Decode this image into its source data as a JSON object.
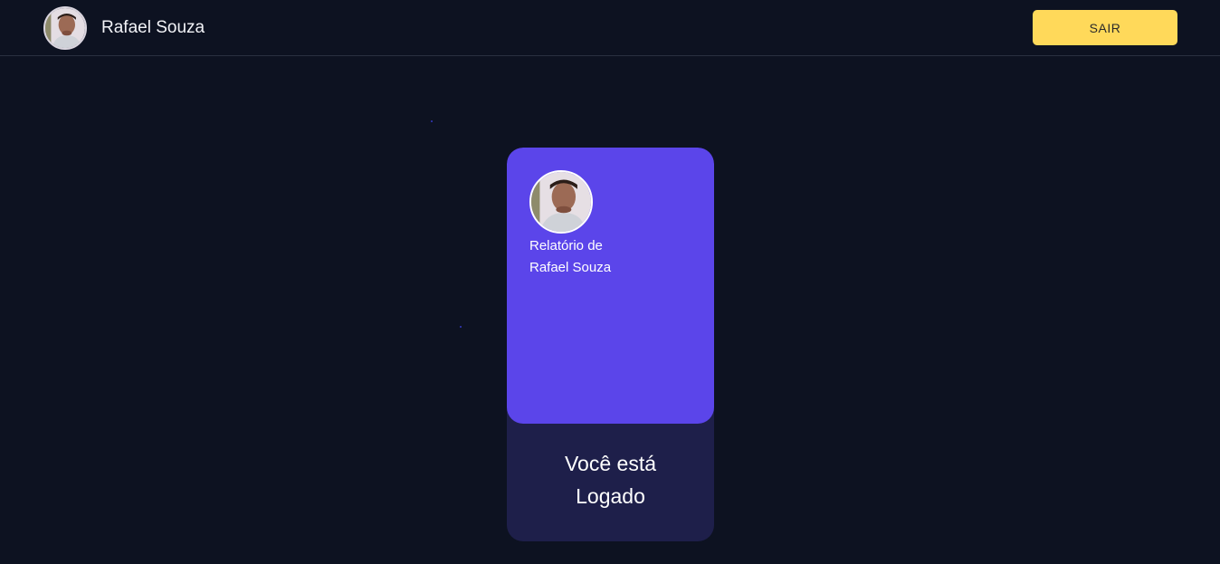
{
  "header": {
    "user_name": "Rafael Souza",
    "avatar_icon": "user-photo-avatar",
    "logout_label": "SAIR"
  },
  "card": {
    "avatar_icon": "user-photo-avatar",
    "report_line1": "Relatório de",
    "report_line2": "Rafael Souza",
    "status_line1": "Você está",
    "status_line2": "Logado"
  },
  "colors": {
    "background": "#0d1221",
    "accent_purple": "#5b45ea",
    "card_bottom": "#1e1f4a",
    "button_yellow": "#ffd95a"
  }
}
